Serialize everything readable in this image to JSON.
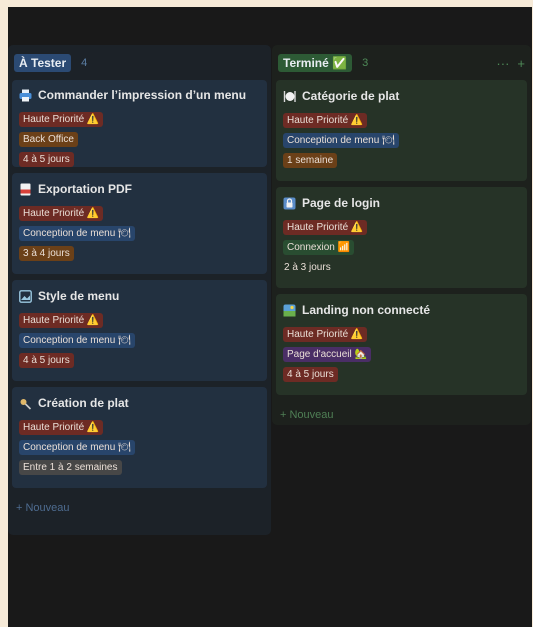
{
  "columns": [
    {
      "title": "À Tester",
      "count": "4",
      "new_label": "+ Nouveau",
      "cards": [
        {
          "title": "Commander l’impression d’un menu",
          "icon": "printer-icon",
          "tags": [
            {
              "label": "Haute Priorité ⚠️",
              "color": "#6d2b24"
            },
            {
              "label": "Back Office",
              "color": "#6b4018"
            },
            {
              "label": "4 à 5 jours",
              "color": "#6d2b24"
            }
          ]
        },
        {
          "title": "Exportation PDF",
          "icon": "pdf-icon",
          "tags": [
            {
              "label": "Haute Priorité ⚠️",
              "color": "#6d2b24"
            },
            {
              "label": "Conception de menu 🍽",
              "color": "#28456b"
            },
            {
              "label": "3 à 4 jours",
              "color": "#6b4018"
            }
          ]
        },
        {
          "title": "Style de menu",
          "icon": "picture-icon",
          "tags": [
            {
              "label": "Haute Priorité ⚠️",
              "color": "#6d2b24"
            },
            {
              "label": "Conception de menu 🍽",
              "color": "#28456b"
            },
            {
              "label": "4 à 5 jours",
              "color": "#6d2b24"
            }
          ]
        },
        {
          "title": "Création de plat",
          "icon": "ladle-icon",
          "tags": [
            {
              "label": "Haute Priorité ⚠️",
              "color": "#6d2b24"
            },
            {
              "label": "Conception de menu 🍽",
              "color": "#28456b"
            },
            {
              "label": "Entre 1 à 2 semaines",
              "color": "#474747"
            }
          ]
        }
      ]
    },
    {
      "title": "Terminé ✅",
      "count": "3",
      "more_label": "···",
      "add_label": "+",
      "new_label": "+ Nouveau",
      "cards": [
        {
          "title": "Catégorie de plat",
          "icon": "plate-icon",
          "tags": [
            {
              "label": "Haute Priorité ⚠️",
              "color": "#6d2b24"
            },
            {
              "label": "Conception de menu 🍽",
              "color": "#28456b"
            },
            {
              "label": "1 semaine",
              "color": "#6b4018"
            }
          ]
        },
        {
          "title": "Page de login",
          "icon": "lock-icon",
          "tags": [
            {
              "label": "Haute Priorité ⚠️",
              "color": "#6d2b24"
            },
            {
              "label": "Connexion 📶",
              "color": "#294d31"
            },
            {
              "label": "2 à 3 jours",
              "color": "transparent"
            }
          ]
        },
        {
          "title": "Landing non connecté",
          "icon": "landscape-icon",
          "tags": [
            {
              "label": "Haute Priorité ⚠️",
              "color": "#6d2b24"
            },
            {
              "label": "Page d'accueil 🏡",
              "color": "#4a2e66"
            },
            {
              "label": "4 à 5 jours",
              "color": "#6d2b24"
            }
          ]
        }
      ]
    }
  ]
}
